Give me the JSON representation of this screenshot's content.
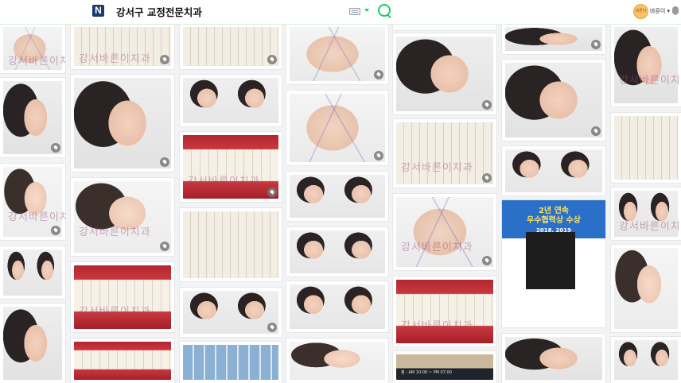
{
  "header": {
    "logo": "N",
    "title": "강서구 교정전문치과",
    "user": {
      "name": "바른이 ▾",
      "avatar_text": "바른이"
    }
  },
  "watermark": "강서바른이치과",
  "award": {
    "title_line1": "2년 연속",
    "title_line2": "우수협력상 수상",
    "years": "2018. 2019"
  },
  "sign": {
    "text": "평 : AM 10:00 ~ PM 07:00"
  }
}
